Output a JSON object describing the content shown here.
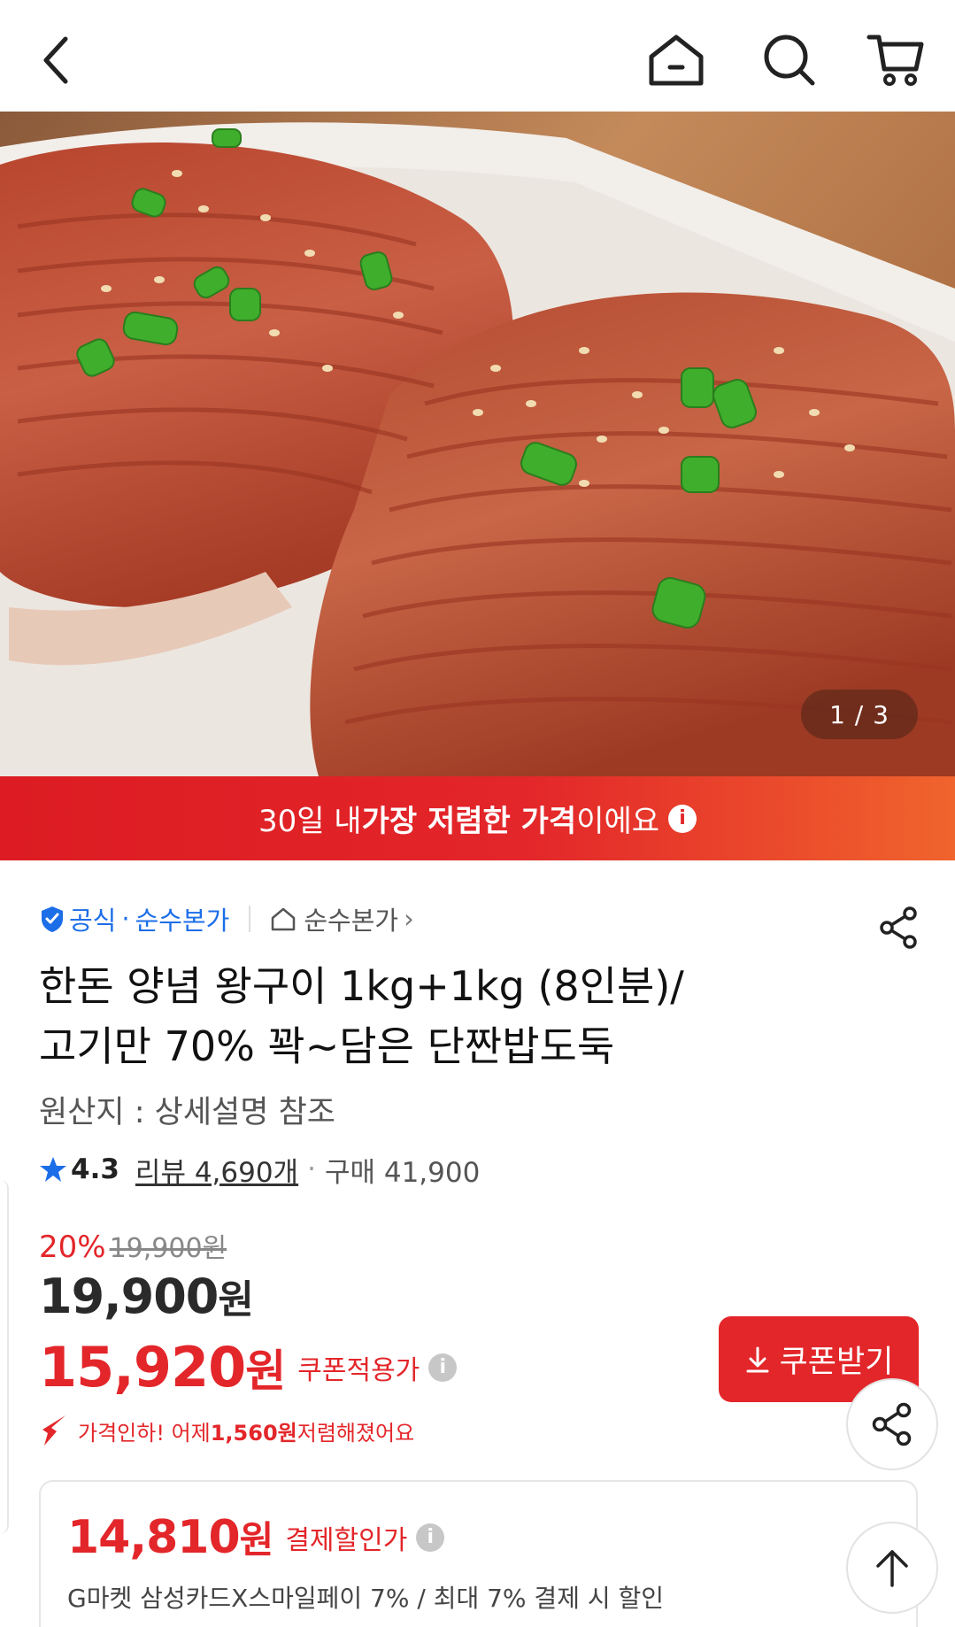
{
  "header": {
    "icons": [
      "back-icon",
      "home-icon",
      "search-icon",
      "cart-icon"
    ]
  },
  "hero": {
    "page_indicator": "1 / 3"
  },
  "banner": {
    "prefix": "30일 내 ",
    "strong": "가장 저렴한 가격",
    "suffix": "이에요",
    "info": "i"
  },
  "seller": {
    "official_label": "공식",
    "dot": "·",
    "brand": "순수본가",
    "store": "순수본가",
    "chevron": "›"
  },
  "product": {
    "title_line1": "한돈 양념 왕구이  1kg+1kg (8인분)/",
    "title_line2": "고기만 70% 꽉~담은 단짠밥도둑",
    "origin": "원산지 : 상세설명 참조"
  },
  "rating": {
    "score": "4.3",
    "reviews": "리뷰 4,690개",
    "dot": "·",
    "purchases": "구매 41,900"
  },
  "price": {
    "discount_rate": "20%",
    "original": "19,900원",
    "current_amount": "19,900",
    "current_unit": "원",
    "coupon_amount": "15,920",
    "coupon_unit": "원",
    "coupon_label": "쿠폰적용가",
    "info": "i"
  },
  "coupon_button": {
    "label": "쿠폰받기"
  },
  "price_drop": {
    "prefix": "가격인하! 어제 ",
    "amount": "1,560원",
    "suffix": " 저렴해졌어요"
  },
  "payment": {
    "amount": "14,810",
    "unit": "원",
    "label": "결제할인가",
    "info": "i",
    "description": "G마켓 삼성카드X스마일페이 7% / 최대 7% 결제 시 할인"
  },
  "colors": {
    "accent_red": "#e3262a",
    "official_blue": "#1c6ee8",
    "star_blue": "#1c6ee8"
  }
}
